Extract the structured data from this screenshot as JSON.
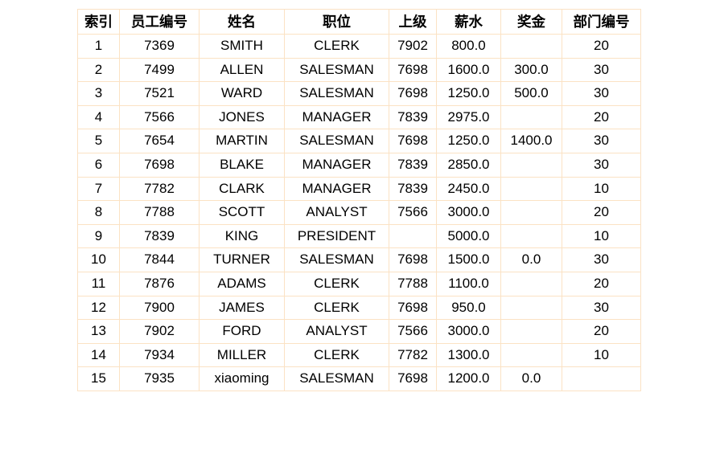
{
  "table": {
    "columns": [
      {
        "key": "index",
        "label": "索引"
      },
      {
        "key": "empno",
        "label": "员工编号"
      },
      {
        "key": "ename",
        "label": "姓名"
      },
      {
        "key": "job",
        "label": "职位"
      },
      {
        "key": "mgr",
        "label": "上级"
      },
      {
        "key": "sal",
        "label": "薪水"
      },
      {
        "key": "comm",
        "label": "奖金"
      },
      {
        "key": "deptno",
        "label": "部门编号"
      }
    ],
    "rows": [
      {
        "index": "1",
        "empno": "7369",
        "ename": "SMITH",
        "job": "CLERK",
        "mgr": "7902",
        "sal": "800.0",
        "comm": "",
        "deptno": "20",
        "sal_highlight": false
      },
      {
        "index": "2",
        "empno": "7499",
        "ename": "ALLEN",
        "job": "SALESMAN",
        "mgr": "7698",
        "sal": "1600.0",
        "comm": "300.0",
        "deptno": "30",
        "sal_highlight": false
      },
      {
        "index": "3",
        "empno": "7521",
        "ename": "WARD",
        "job": "SALESMAN",
        "mgr": "7698",
        "sal": "1250.0",
        "comm": "500.0",
        "deptno": "30",
        "sal_highlight": false
      },
      {
        "index": "4",
        "empno": "7566",
        "ename": "JONES",
        "job": "MANAGER",
        "mgr": "7839",
        "sal": "2975.0",
        "comm": "",
        "deptno": "20",
        "sal_highlight": true
      },
      {
        "index": "5",
        "empno": "7654",
        "ename": "MARTIN",
        "job": "SALESMAN",
        "mgr": "7698",
        "sal": "1250.0",
        "comm": "1400.0",
        "deptno": "30",
        "sal_highlight": false
      },
      {
        "index": "6",
        "empno": "7698",
        "ename": "BLAKE",
        "job": "MANAGER",
        "mgr": "7839",
        "sal": "2850.0",
        "comm": "",
        "deptno": "30",
        "sal_highlight": true
      },
      {
        "index": "7",
        "empno": "7782",
        "ename": "CLARK",
        "job": "MANAGER",
        "mgr": "7839",
        "sal": "2450.0",
        "comm": "",
        "deptno": "10",
        "sal_highlight": true
      },
      {
        "index": "8",
        "empno": "7788",
        "ename": "SCOTT",
        "job": "ANALYST",
        "mgr": "7566",
        "sal": "3000.0",
        "comm": "",
        "deptno": "20",
        "sal_highlight": true
      },
      {
        "index": "9",
        "empno": "7839",
        "ename": "KING",
        "job": "PRESIDENT",
        "mgr": "",
        "sal": "5000.0",
        "comm": "",
        "deptno": "10",
        "sal_highlight": true
      },
      {
        "index": "10",
        "empno": "7844",
        "ename": "TURNER",
        "job": "SALESMAN",
        "mgr": "7698",
        "sal": "1500.0",
        "comm": "0.0",
        "deptno": "30",
        "sal_highlight": false
      },
      {
        "index": "11",
        "empno": "7876",
        "ename": "ADAMS",
        "job": "CLERK",
        "mgr": "7788",
        "sal": "1100.0",
        "comm": "",
        "deptno": "20",
        "sal_highlight": false
      },
      {
        "index": "12",
        "empno": "7900",
        "ename": "JAMES",
        "job": "CLERK",
        "mgr": "7698",
        "sal": "950.0",
        "comm": "",
        "deptno": "30",
        "sal_highlight": false
      },
      {
        "index": "13",
        "empno": "7902",
        "ename": "FORD",
        "job": "ANALYST",
        "mgr": "7566",
        "sal": "3000.0",
        "comm": "",
        "deptno": "20",
        "sal_highlight": true
      },
      {
        "index": "14",
        "empno": "7934",
        "ename": "MILLER",
        "job": "CLERK",
        "mgr": "7782",
        "sal": "1300.0",
        "comm": "",
        "deptno": "10",
        "sal_highlight": false
      },
      {
        "index": "15",
        "empno": "7935",
        "ename": "xiaoming",
        "job": "SALESMAN",
        "mgr": "7698",
        "sal": "1200.0",
        "comm": "0.0",
        "deptno": "",
        "sal_highlight": false
      }
    ]
  },
  "colors": {
    "border": "#fbe2c4",
    "text": "#000000",
    "highlight": "#ff0000",
    "background": "#ffffff"
  }
}
